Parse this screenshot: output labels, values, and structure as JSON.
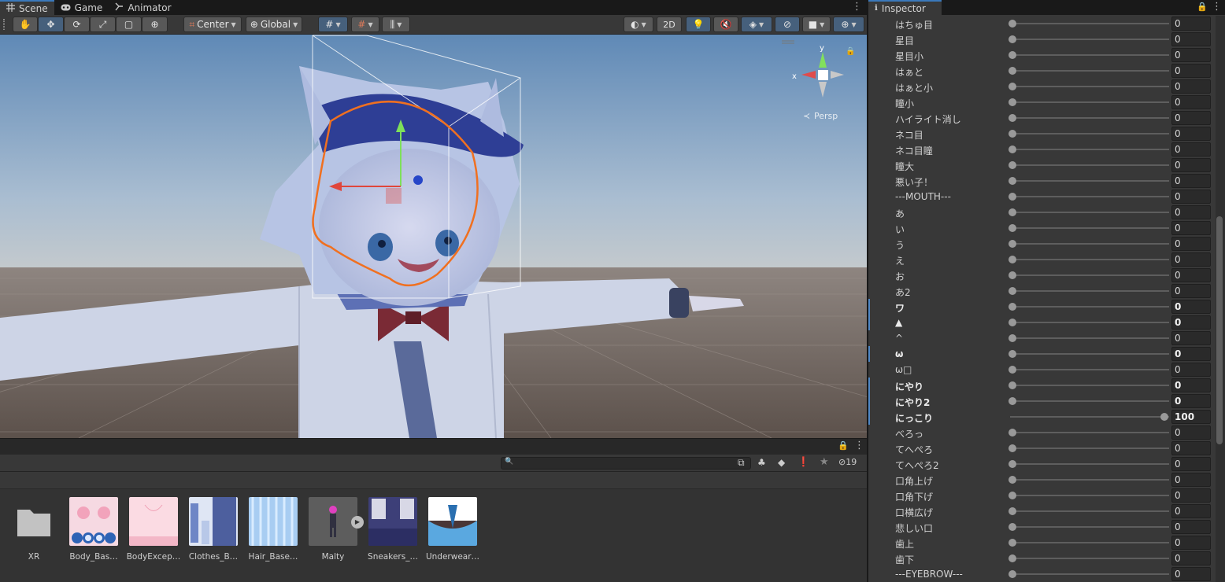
{
  "scene_panel": {
    "tabs": [
      {
        "label": "Scene",
        "icon": "scene-grid-icon"
      },
      {
        "label": "Game",
        "icon": "gamepad-icon"
      },
      {
        "label": "Animator",
        "icon": "animator-icon"
      }
    ]
  },
  "toolbar": {
    "pivot_label": "Center",
    "space_label": "Global",
    "mode_2d": "2D"
  },
  "gizmo": {
    "x_label": "x",
    "y_label": "y",
    "persp_label": "Persp"
  },
  "project": {
    "hidden_count": "19",
    "assets": [
      {
        "name": "XR",
        "kind": "folder"
      },
      {
        "name": "Body_Bas…",
        "kind": "texture"
      },
      {
        "name": "BodyExcep…",
        "kind": "texture"
      },
      {
        "name": "Clothes_B…",
        "kind": "texture"
      },
      {
        "name": "Hair_Base…",
        "kind": "texture"
      },
      {
        "name": "Malty",
        "kind": "prefab"
      },
      {
        "name": "Sneakers_…",
        "kind": "texture"
      },
      {
        "name": "Underwear…",
        "kind": "texture"
      }
    ]
  },
  "inspector": {
    "title": "Inspector",
    "blendshapes": [
      {
        "label": "はちゅ目",
        "value": "0",
        "pct": 0,
        "modified": false
      },
      {
        "label": "星目",
        "value": "0",
        "pct": 0,
        "modified": false
      },
      {
        "label": "星目小",
        "value": "0",
        "pct": 0,
        "modified": false
      },
      {
        "label": "はぁと",
        "value": "0",
        "pct": 0,
        "modified": false
      },
      {
        "label": "はぁと小",
        "value": "0",
        "pct": 0,
        "modified": false
      },
      {
        "label": "瞳小",
        "value": "0",
        "pct": 0,
        "modified": false
      },
      {
        "label": "ハイライト消し",
        "value": "0",
        "pct": 0,
        "modified": false
      },
      {
        "label": "ネコ目",
        "value": "0",
        "pct": 0,
        "modified": false
      },
      {
        "label": "ネコ目瞳",
        "value": "0",
        "pct": 0,
        "modified": false
      },
      {
        "label": "瞳大",
        "value": "0",
        "pct": 0,
        "modified": false
      },
      {
        "label": "悪い子！",
        "value": "0",
        "pct": 0,
        "modified": false
      },
      {
        "label": "---MOUTH---",
        "value": "0",
        "pct": 0,
        "modified": false
      },
      {
        "label": "あ",
        "value": "0",
        "pct": 0,
        "modified": false
      },
      {
        "label": "い",
        "value": "0",
        "pct": 0,
        "modified": false
      },
      {
        "label": "う",
        "value": "0",
        "pct": 0,
        "modified": false
      },
      {
        "label": "え",
        "value": "0",
        "pct": 0,
        "modified": false
      },
      {
        "label": "お",
        "value": "0",
        "pct": 0,
        "modified": false
      },
      {
        "label": "あ2",
        "value": "0",
        "pct": 0,
        "modified": false
      },
      {
        "label": "ワ",
        "value": "0",
        "pct": 0,
        "modified": true
      },
      {
        "label": "▲",
        "value": "0",
        "pct": 0,
        "modified": true
      },
      {
        "label": "^",
        "value": "0",
        "pct": 0,
        "modified": false
      },
      {
        "label": "ω",
        "value": "0",
        "pct": 0,
        "modified": true
      },
      {
        "label": "ω□",
        "value": "0",
        "pct": 0,
        "modified": false
      },
      {
        "label": "にやり",
        "value": "0",
        "pct": 0,
        "modified": true
      },
      {
        "label": "にやり2",
        "value": "0",
        "pct": 0,
        "modified": true
      },
      {
        "label": "にっこり",
        "value": "100",
        "pct": 100,
        "modified": true
      },
      {
        "label": "べろっ",
        "value": "0",
        "pct": 0,
        "modified": false
      },
      {
        "label": "てへぺろ",
        "value": "0",
        "pct": 0,
        "modified": false
      },
      {
        "label": "てへぺろ2",
        "value": "0",
        "pct": 0,
        "modified": false
      },
      {
        "label": "口角上げ",
        "value": "0",
        "pct": 0,
        "modified": false
      },
      {
        "label": "口角下げ",
        "value": "0",
        "pct": 0,
        "modified": false
      },
      {
        "label": "口横広げ",
        "value": "0",
        "pct": 0,
        "modified": false
      },
      {
        "label": "悲しい口",
        "value": "0",
        "pct": 0,
        "modified": false
      },
      {
        "label": "歯上",
        "value": "0",
        "pct": 0,
        "modified": false
      },
      {
        "label": "歯下",
        "value": "0",
        "pct": 0,
        "modified": false
      },
      {
        "label": "---EYEBROW---",
        "value": "0",
        "pct": 0,
        "modified": false
      }
    ]
  }
}
